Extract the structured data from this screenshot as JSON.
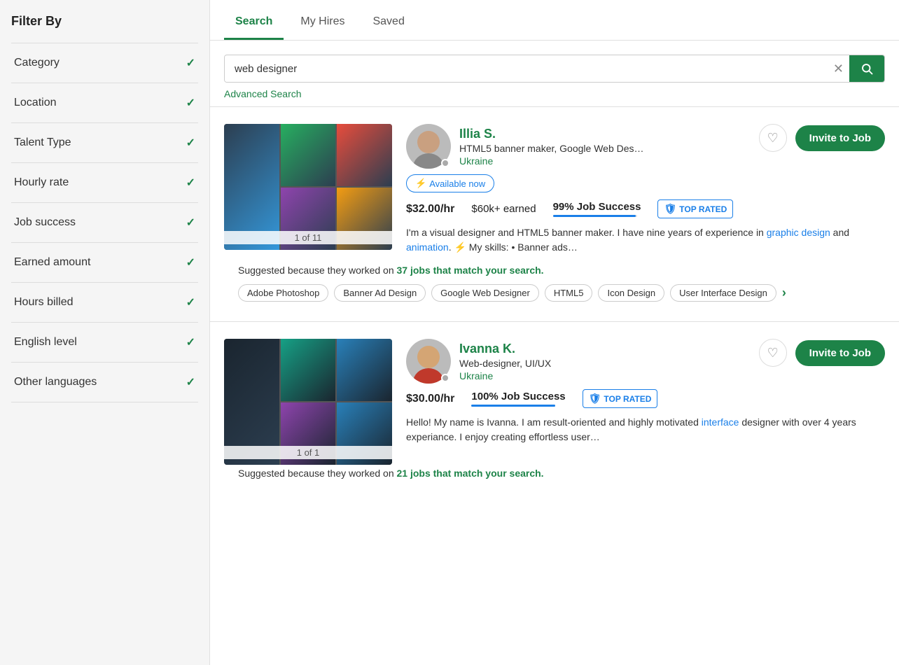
{
  "sidebar": {
    "title": "Filter By",
    "filters": [
      {
        "id": "category",
        "label": "Category"
      },
      {
        "id": "location",
        "label": "Location"
      },
      {
        "id": "talent-type",
        "label": "Talent Type"
      },
      {
        "id": "hourly-rate",
        "label": "Hourly rate"
      },
      {
        "id": "job-success",
        "label": "Job success"
      },
      {
        "id": "earned-amount",
        "label": "Earned amount"
      },
      {
        "id": "hours-billed",
        "label": "Hours billed"
      },
      {
        "id": "english-level",
        "label": "English level"
      },
      {
        "id": "other-languages",
        "label": "Other languages"
      }
    ]
  },
  "tabs": [
    {
      "id": "search",
      "label": "Search",
      "active": true
    },
    {
      "id": "my-hires",
      "label": "My Hires",
      "active": false
    },
    {
      "id": "saved",
      "label": "Saved",
      "active": false
    }
  ],
  "search": {
    "value": "web designer",
    "placeholder": "Search",
    "advanced_link": "Advanced Search"
  },
  "candidates": [
    {
      "id": "illia",
      "name": "Illia S.",
      "title": "HTML5 banner maker, Google Web Des…",
      "location": "Ukraine",
      "available": true,
      "available_label": "Available now",
      "rate": "$32.00/hr",
      "earned": "$60k+ earned",
      "job_success": "99% Job Success",
      "job_success_pct": 99,
      "top_rated": true,
      "top_rated_label": "TOP RATED",
      "bio": "I'm a visual designer and HTML5 banner maker. I have nine years of experience in graphic design and animation. ⚡ My skills: • Banner ads…",
      "suggested_text": "Suggested because they worked on ",
      "suggested_link": "37 jobs that match your search.",
      "skills": [
        "Adobe Photoshop",
        "Banner Ad Design",
        "Google Web Designer",
        "HTML5",
        "Icon Design",
        "User Interface Design"
      ],
      "portfolio_count": "1 of 11",
      "invite_label": "Invite to Job"
    },
    {
      "id": "ivanna",
      "name": "Ivanna K.",
      "title": "Web-designer, UI/UX",
      "location": "Ukraine",
      "available": false,
      "available_label": "",
      "rate": "$30.00/hr",
      "earned": "",
      "job_success": "100% Job Success",
      "job_success_pct": 100,
      "top_rated": true,
      "top_rated_label": "TOP RATED",
      "bio": "Hello! My name is Ivanna. I am result-oriented and highly motivated interface designer with over 4 years experiance. I enjoy creating effortless user…",
      "suggested_text": "Suggested because they worked on ",
      "suggested_link": "21 jobs that match your search.",
      "skills": [],
      "portfolio_count": "1 of 1",
      "invite_label": "Invite to Job"
    }
  ]
}
